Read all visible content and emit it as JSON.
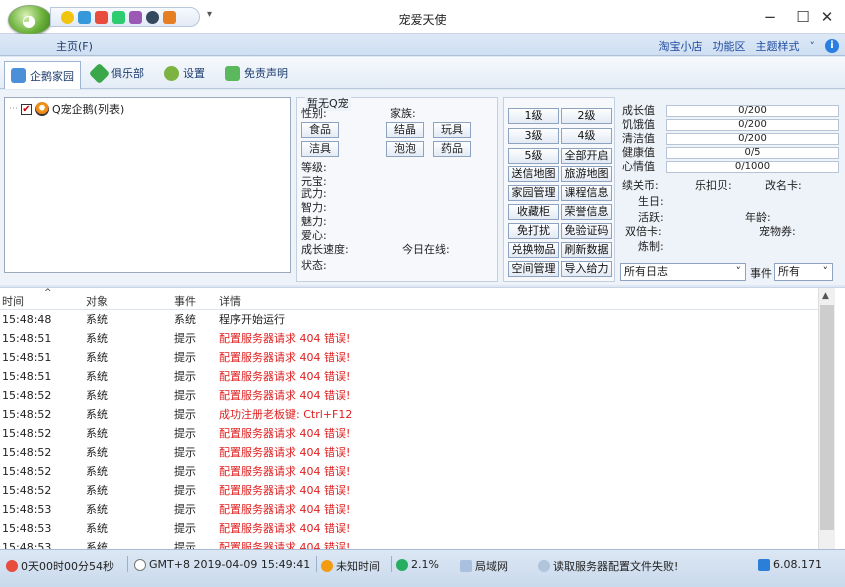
{
  "window": {
    "title": "宠爱天使",
    "minimize": "−",
    "maximize": "☐",
    "close": "✕"
  },
  "ribbon": {
    "home_tab": "主页(F)",
    "right_links": [
      "淘宝小店",
      "功能区",
      "主题样式",
      "˅"
    ],
    "help": "i"
  },
  "toolbar": {
    "items": [
      {
        "label": "企鹅家园",
        "icon": "house-icon",
        "color": "#4a8fd8"
      },
      {
        "label": "俱乐部",
        "icon": "club-icon",
        "color": "#3aa84a"
      },
      {
        "label": "设置",
        "icon": "gear-icon",
        "color": "#7cb342"
      },
      {
        "label": "免责声明",
        "icon": "shield-icon",
        "color": "#5cb85c"
      }
    ]
  },
  "tree": {
    "dots": "⋯",
    "check": "✔",
    "root_label": "Q宠企鹅(列表)"
  },
  "pet": {
    "name": "暂无Q宠",
    "gender_label": "性别:",
    "family_label": "家族:",
    "buttons_row1": [
      "食品",
      "结晶",
      "玩具"
    ],
    "buttons_row2": [
      "洁具",
      "泡泡",
      "药品"
    ],
    "attrs": [
      "等级:",
      "元宝:",
      "武力:",
      "智力:",
      "魅力:",
      "爱心:"
    ],
    "growth_label": "成长速度:",
    "online_label": "今日在线:",
    "status_label": "状态:"
  },
  "actions": {
    "grid": [
      [
        "1级",
        "2级"
      ],
      [
        "3级",
        "4级"
      ],
      [
        "5级",
        "全部开启"
      ],
      [
        "送信地图",
        "旅游地图"
      ],
      [
        "家园管理",
        "课程信息"
      ],
      [
        "收藏柜",
        "荣誉信息"
      ],
      [
        "免打扰",
        "免验证码"
      ],
      [
        "兑换物品",
        "刷新数据"
      ],
      [
        "空间管理",
        "导入给力"
      ]
    ]
  },
  "stats": {
    "bars": [
      {
        "label": "成长值",
        "value": "0/200"
      },
      {
        "label": "饥饿值",
        "value": "0/200"
      },
      {
        "label": "清洁值",
        "value": "0/200"
      },
      {
        "label": "健康值",
        "value": "0/5"
      },
      {
        "label": "心情值",
        "value": "0/1000"
      }
    ],
    "continue_label": "续关币:",
    "lekou_label": "乐扣贝:",
    "rename_label": "改名卡:",
    "birthday_label": "生日:",
    "active_label": "活跃:",
    "age_label": "年龄:",
    "double_label": "双倍卡:",
    "petcoupon_label": "宠物券:",
    "refine_label": "炼制:",
    "log_filter": "所有日志",
    "event_label": "事件",
    "event_filter": "所有",
    "chevron": "˅"
  },
  "log": {
    "columns": [
      "时间",
      "对象",
      "事件",
      "详情"
    ],
    "sort_arrow": "^",
    "rows": [
      {
        "time": "15:48:48",
        "object": "系统",
        "event": "系统",
        "detail": "程序开始运行",
        "color": "#222222"
      },
      {
        "time": "15:48:51",
        "object": "系统",
        "event": "提示",
        "detail": "配置服务器请求 404 错误!",
        "color": "#e02020"
      },
      {
        "time": "15:48:51",
        "object": "系统",
        "event": "提示",
        "detail": "配置服务器请求 404 错误!",
        "color": "#e02020"
      },
      {
        "time": "15:48:51",
        "object": "系统",
        "event": "提示",
        "detail": "配置服务器请求 404 错误!",
        "color": "#e02020"
      },
      {
        "time": "15:48:52",
        "object": "系统",
        "event": "提示",
        "detail": "配置服务器请求 404 错误!",
        "color": "#e02020"
      },
      {
        "time": "15:48:52",
        "object": "系统",
        "event": "提示",
        "detail": "成功注册老板键: Ctrl+F12",
        "color": "#e02020"
      },
      {
        "time": "15:48:52",
        "object": "系统",
        "event": "提示",
        "detail": "配置服务器请求 404 错误!",
        "color": "#e02020"
      },
      {
        "time": "15:48:52",
        "object": "系统",
        "event": "提示",
        "detail": "配置服务器请求 404 错误!",
        "color": "#e02020"
      },
      {
        "time": "15:48:52",
        "object": "系统",
        "event": "提示",
        "detail": "配置服务器请求 404 错误!",
        "color": "#e02020"
      },
      {
        "time": "15:48:52",
        "object": "系统",
        "event": "提示",
        "detail": "配置服务器请求 404 错误!",
        "color": "#e02020"
      },
      {
        "time": "15:48:53",
        "object": "系统",
        "event": "提示",
        "detail": "配置服务器请求 404 错误!",
        "color": "#e02020"
      },
      {
        "time": "15:48:53",
        "object": "系统",
        "event": "提示",
        "detail": "配置服务器请求 404 错误!",
        "color": "#e02020"
      },
      {
        "time": "15:48:53",
        "object": "系统",
        "event": "提示",
        "detail": "配置服务器请求 404 错误!",
        "color": "#e02020"
      }
    ]
  },
  "status": {
    "uptime": "0天00时00分54秒",
    "clock": "GMT+8 2019-04-09 15:49:41",
    "time_source": "未知时间",
    "cpu": "2.1%",
    "network": "局域网",
    "message": "读取服务器配置文件失败!",
    "version": "6.08.171"
  }
}
